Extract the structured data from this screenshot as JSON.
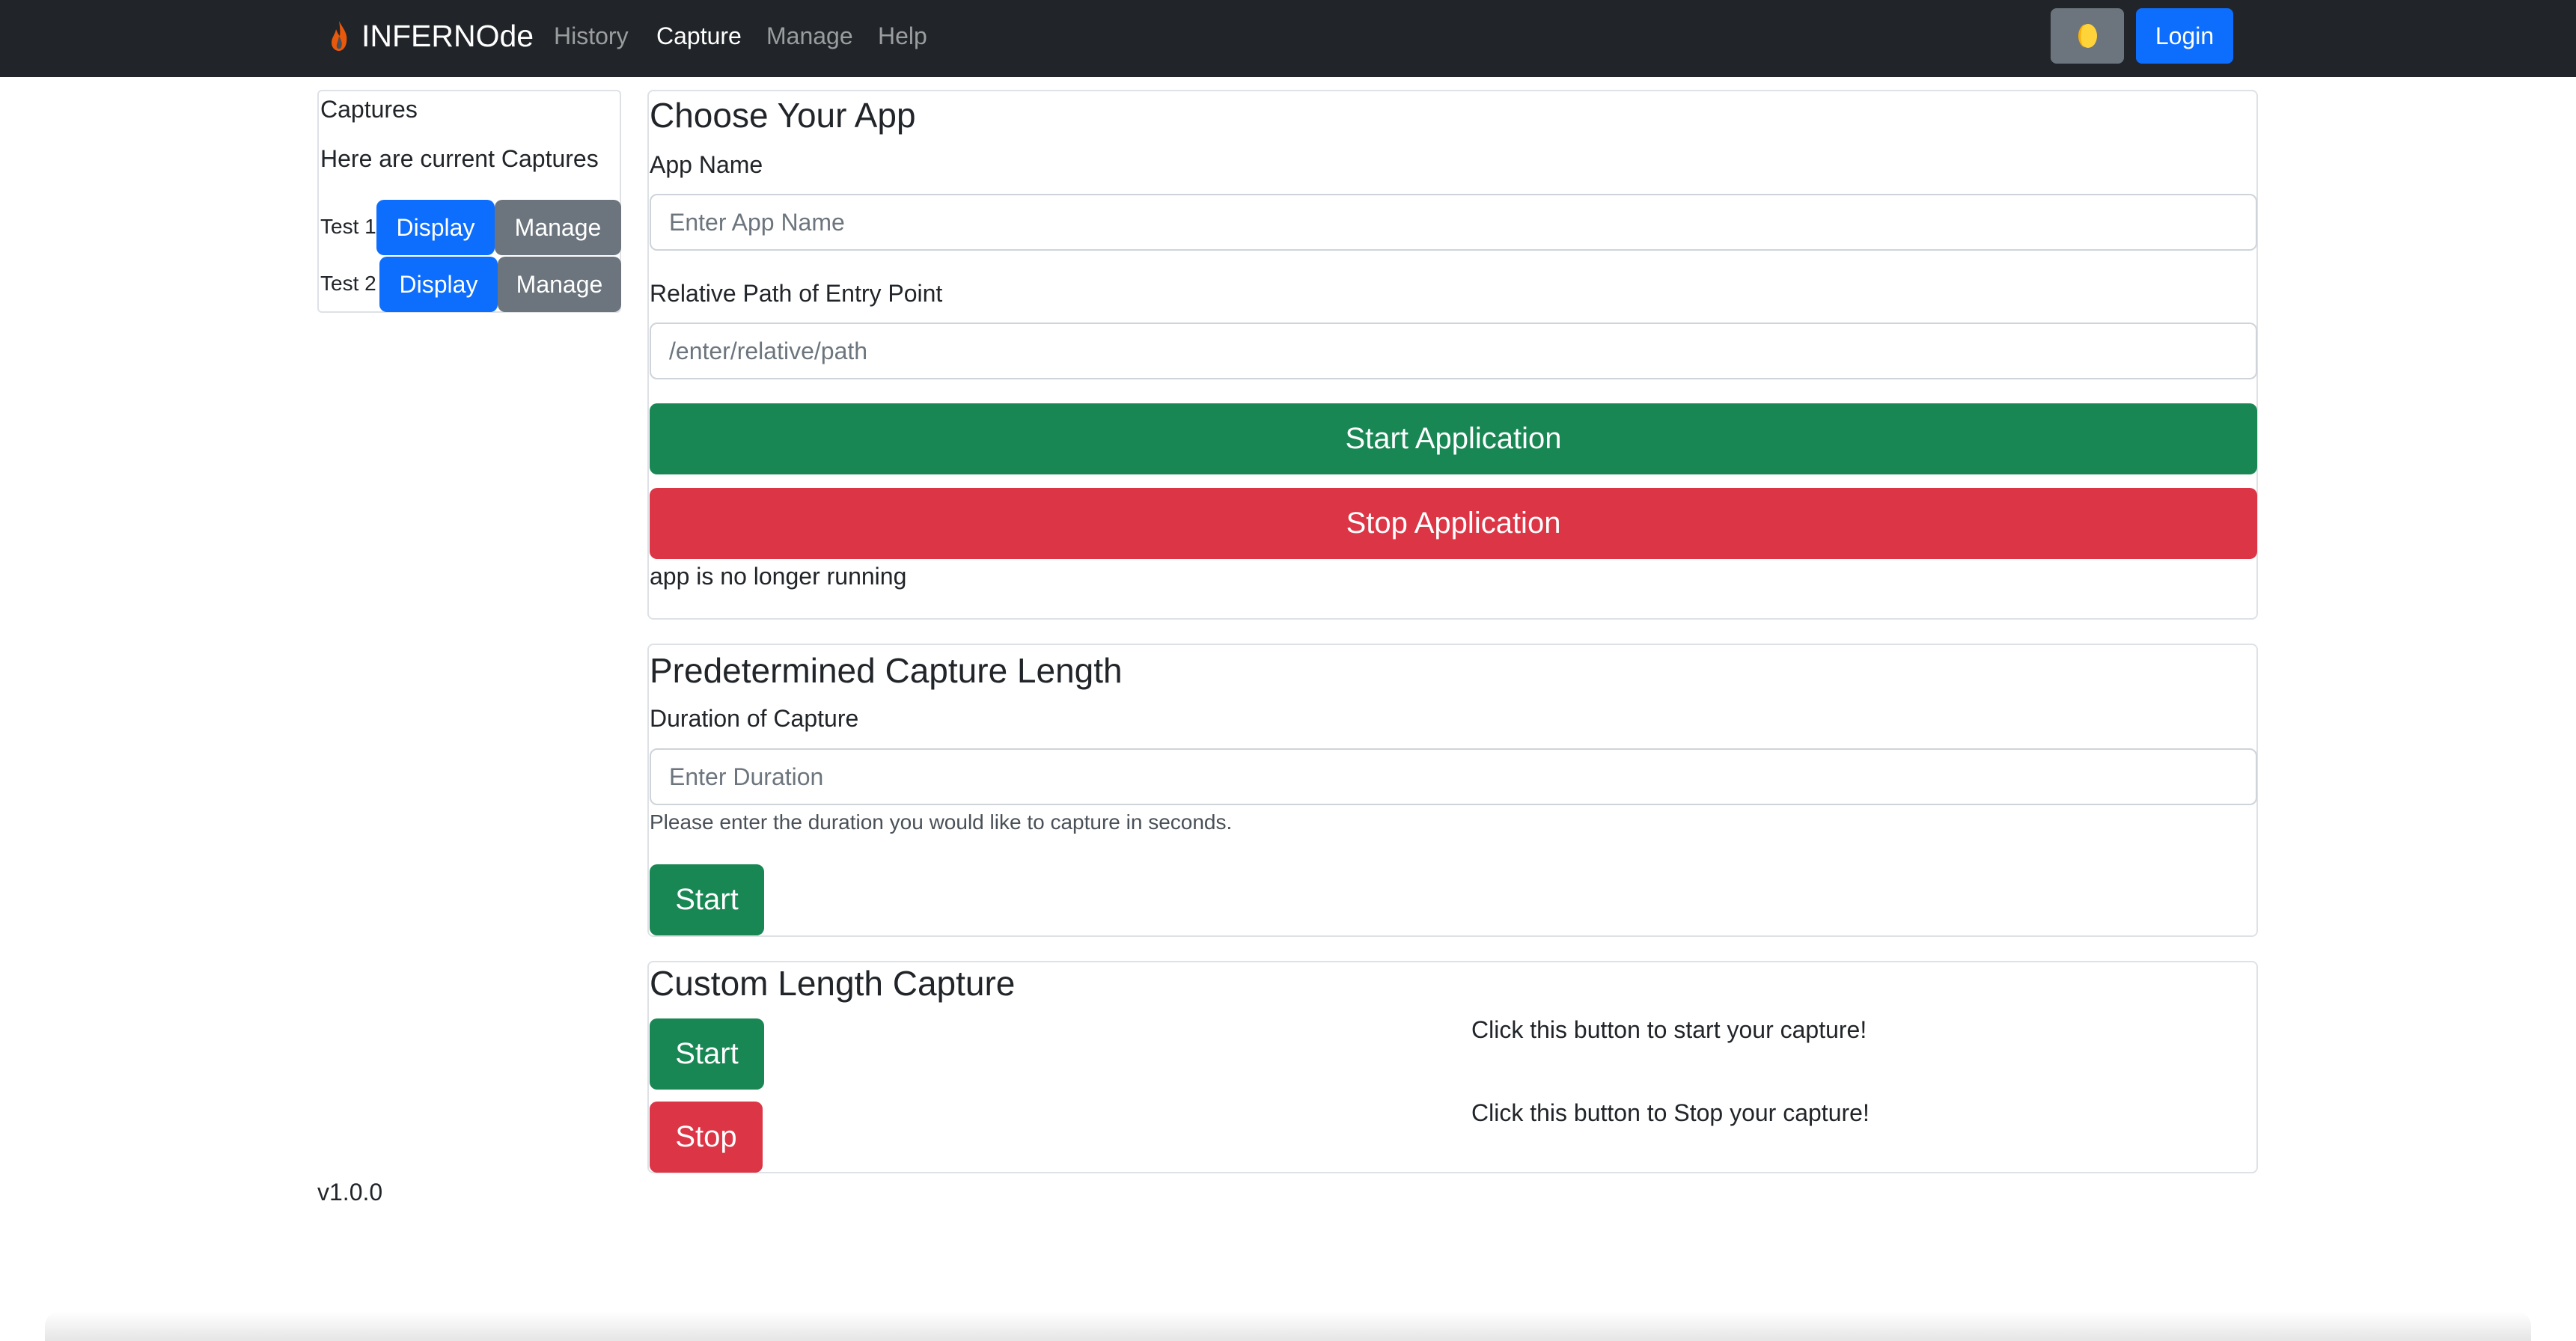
{
  "navbar": {
    "brand": "INFERNOde",
    "links": [
      "History",
      "Capture",
      "Manage",
      "Help"
    ],
    "active_link": "Capture",
    "theme_icon": "moon-icon",
    "login_label": "Login"
  },
  "sidebar": {
    "title": "Captures",
    "subtitle": "Here are current Captures",
    "captures": [
      {
        "label": "Test 1",
        "display_label": "Display",
        "manage_label": "Manage"
      },
      {
        "label": "Test 2",
        "display_label": "Display",
        "manage_label": "Manage"
      }
    ],
    "version": "v1.0.0"
  },
  "choose_app": {
    "title": "Choose Your App",
    "app_name_label": "App Name",
    "app_name_placeholder": "Enter App Name",
    "app_name_value": "",
    "path_label": "Relative Path of Entry Point",
    "path_placeholder": "/enter/relative/path",
    "path_value": "",
    "start_label": "Start Application",
    "stop_label": "Stop Application",
    "status": "app is no longer running"
  },
  "predetermined": {
    "title": "Predetermined Capture Length",
    "duration_label": "Duration of Capture",
    "duration_placeholder": "Enter Duration",
    "duration_value": "",
    "help": "Please enter the duration you would like to capture in seconds.",
    "start_label": "Start"
  },
  "custom": {
    "title": "Custom Length Capture",
    "start_label": "Start",
    "stop_label": "Stop",
    "start_hint": "Click this button to start your capture!",
    "stop_hint": "Click this button to Stop your capture!"
  },
  "colors": {
    "navbar": "#212529",
    "primary": "#0d6efd",
    "secondary": "#6c757d",
    "success": "#198754",
    "danger": "#dc3545"
  }
}
